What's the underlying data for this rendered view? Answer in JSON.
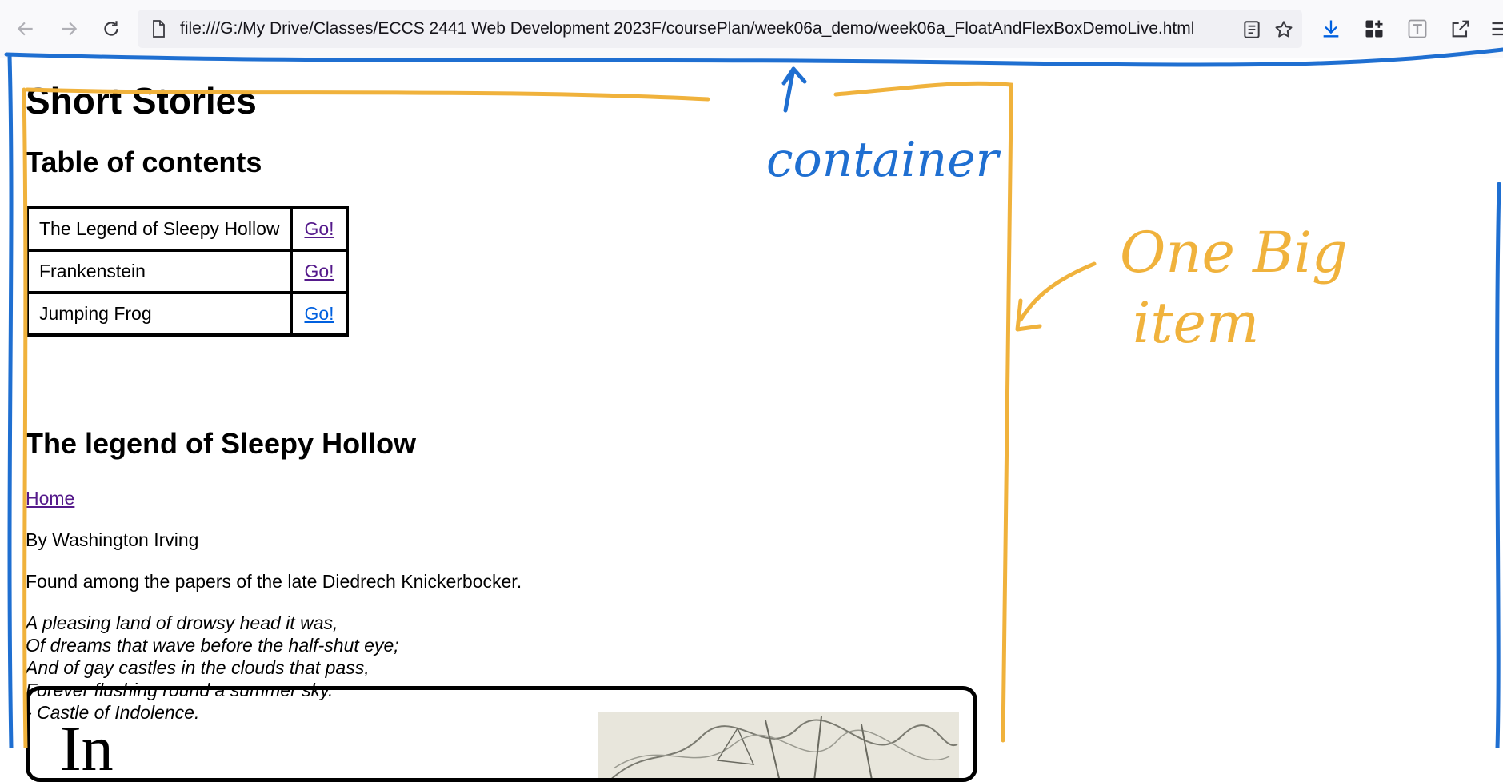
{
  "browser": {
    "url": "file:///G:/My Drive/Classes/ECCS 2441 Web Development 2023F/coursePlan/week06a_demo/week06a_FloatAndFlexBoxDemoLive.html",
    "icons": [
      "back-icon",
      "forward-icon",
      "reload-icon",
      "page-icon",
      "reader-view-icon",
      "bookmark-star-icon",
      "downloads-icon",
      "extensions-grid-icon",
      "translate-icon",
      "share-icon",
      "menu-icon"
    ]
  },
  "page": {
    "title": "Short Stories",
    "toc_heading": "Table of contents",
    "toc": [
      {
        "name": "The Legend of Sleepy Hollow",
        "link": "Go!"
      },
      {
        "name": "Frankenstein",
        "link": "Go!"
      },
      {
        "name": "Jumping Frog",
        "link": "Go!"
      }
    ],
    "story_heading": "The legend of Sleepy Hollow",
    "home_link": "Home",
    "author": "By Washington Irving",
    "found": "Found among the papers of the late Diedrech Knickerbocker.",
    "poem": [
      "A pleasing land of drowsy head it was,",
      "Of dreams that wave before the half-shut eye;",
      "And of gay castles in the clouds that pass,",
      "Forever flushing round a summer sky.",
      "- Castle of Indolence."
    ],
    "drop_cap": "In"
  },
  "annotations": {
    "container": "container",
    "item_line1": "One Big",
    "item_line2": "item",
    "blue": "#1f6fd1",
    "orange": "#f0b23c"
  }
}
